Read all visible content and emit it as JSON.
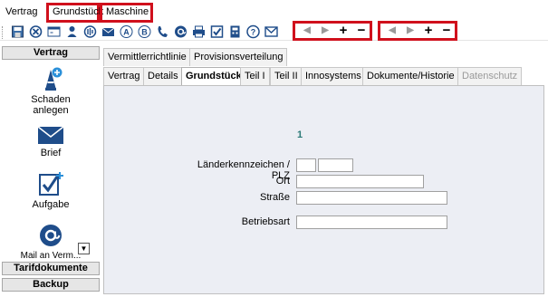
{
  "menu": {
    "items": [
      "Vertrag",
      "Grundstück",
      "Maschine"
    ]
  },
  "toolbar": {
    "icons": [
      "save-icon",
      "cancel-icon",
      "window-icon",
      "person-icon",
      "chart-icon",
      "mail-icon",
      "letter-a-icon",
      "letter-b-icon",
      "phone-icon",
      "at-icon",
      "printer-icon",
      "checklist-icon",
      "calculator-icon",
      "help-icon",
      "email-icon"
    ],
    "nav1": {
      "prev": "◀",
      "next": "▶",
      "add": "+",
      "remove": "−"
    },
    "nav2": {
      "prev": "◀",
      "next": "▶",
      "add": "+",
      "remove": "−"
    }
  },
  "sidebar": {
    "header": "Vertrag",
    "items": [
      {
        "label_line1": "Schaden",
        "label_line2": "anlegen",
        "icon": "damage-icon"
      },
      {
        "label_line1": "Brief",
        "icon": "envelope-icon"
      },
      {
        "label_line1": "Aufgabe",
        "icon": "task-icon"
      },
      {
        "label_line1": "Mail an Verm...",
        "icon": "mail-at-icon"
      }
    ],
    "footer_1": "Tarifdokumente",
    "footer_2": "Backup"
  },
  "tabs_top": [
    "Vermittlerrichtlinie",
    "Provisionsverteilung"
  ],
  "tabs_main": [
    "Vertrag",
    "Details",
    "Grundstück",
    "Teil I",
    "Teil II",
    "Innosystems",
    "Dokumente/Historie",
    "Datenschutz"
  ],
  "form": {
    "counter": "1",
    "labels": {
      "plz": "Länderkennzeichen / PLZ",
      "ort": "Ort",
      "strasse": "Straße",
      "betriebsart": "Betriebsart"
    },
    "values": {
      "country": "",
      "plz": "",
      "ort": "",
      "strasse": "",
      "betriebsart": ""
    }
  },
  "colors": {
    "highlight": "#d0101c",
    "panel": "#eceef4",
    "counter": "#2b7a77"
  }
}
